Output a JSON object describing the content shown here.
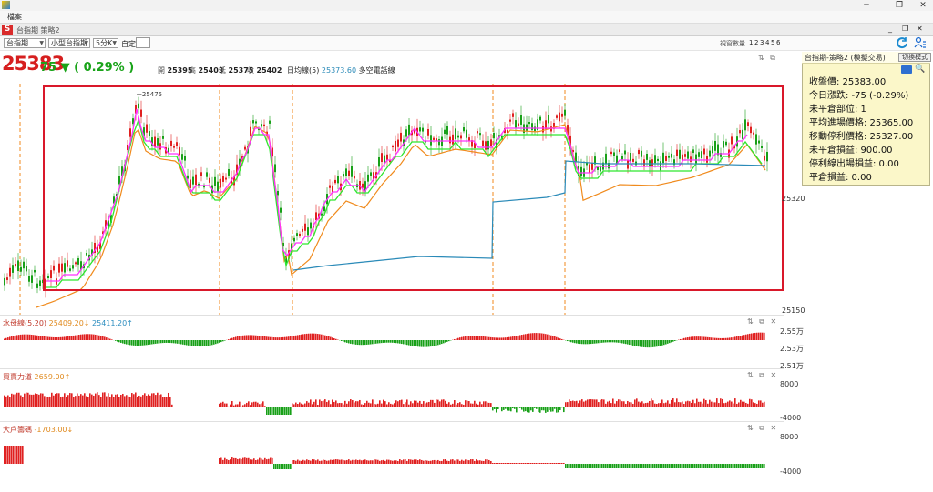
{
  "window": {
    "menu_label": "檔案",
    "subtitle": "台指期 策略2",
    "controls": [
      "─",
      "❐",
      "✕"
    ],
    "sub_controls": [
      "_",
      "❐",
      "✕"
    ]
  },
  "toolbar": {
    "selects": [
      "台指期",
      "小型台指期",
      "5分K"
    ],
    "custom_label": "自定:",
    "window_count_label": "視窗數量",
    "window_counts": [
      "1",
      "2",
      "3",
      "4",
      "5",
      "6"
    ]
  },
  "quote": {
    "price": "25383",
    "change": "75 ▼ ( 0.29% )",
    "ohlc": [
      {
        "label": "開",
        "value": "25395"
      },
      {
        "label": "高",
        "value": "25403"
      },
      {
        "label": "低",
        "value": "25375"
      },
      {
        "label": "收",
        "value": "25402"
      }
    ],
    "ma_label": "日均線(5)",
    "ma_value": "25373.60",
    "line_label": "多空電話線",
    "peak_label": "←25475"
  },
  "main_axis": {
    "labels": [
      "25320",
      "25150"
    ]
  },
  "panes": [
    {
      "name": "水母線(5,20)",
      "v1": "25409.20↓",
      "v2": "25411.20↑",
      "axis": [
        "2.55万",
        "2.53万",
        "2.51万"
      ]
    },
    {
      "name": "買賣力道",
      "v1": "2659.00↑",
      "axis": [
        "8000",
        "-4000"
      ]
    },
    {
      "name": "大戶籌碼",
      "v1": "-1703.00↓",
      "axis": [
        "8000",
        "-4000"
      ]
    }
  ],
  "side_panel": {
    "title": "台指期-策略2 (模擬交易)",
    "switch_button": "切換模式",
    "lines": [
      "收盤價: 25383.00",
      "今日漲跌: -75 (-0.29%)",
      "未平倉部位: 1",
      "平均進場價格: 25365.00",
      "移動停利價格: 25327.00",
      "未平倉損益: 900.00",
      "停利線出場損益: 0.00",
      "平倉損益: 0.00"
    ]
  },
  "colors": {
    "up": "#e02020",
    "down": "#18a018",
    "highlight_box": "#d9182a",
    "ma_orange": "#f08a1c",
    "line_blue": "#2a8ab8",
    "stop_green": "#2ee62e",
    "stop_magenta": "#ff30ff"
  },
  "icons": [
    "app-logo-icon",
    "refresh-icon",
    "person-list-icon",
    "settings-icon",
    "close-icon"
  ]
}
